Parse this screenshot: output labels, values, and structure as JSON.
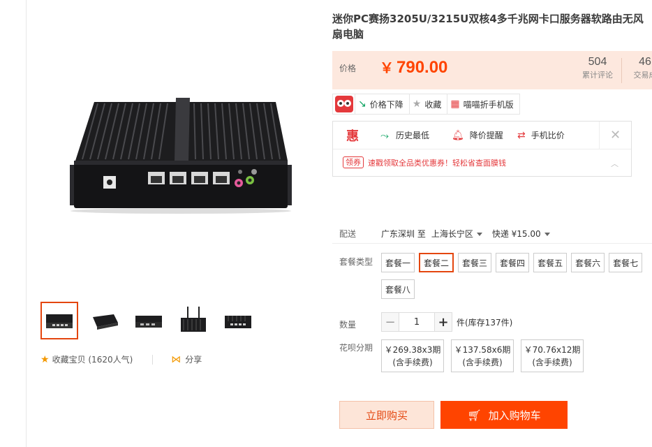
{
  "product": {
    "title": "迷你PC赛扬3205U/3215U双核4多千兆网卡口服务器软路由无风扇电脑",
    "thumbnails_count": 5
  },
  "price": {
    "label": "价格",
    "currency": "￥",
    "value": "790.00",
    "reviews_count": "504",
    "reviews_label": "累计评论",
    "deals_count": "46",
    "deals_label": "交易成"
  },
  "toolbar": {
    "price_drop": "价格下降",
    "collect": "收藏",
    "mobile": "喵喵折手机版"
  },
  "deal": {
    "hui": "惠",
    "history_low": "历史最低",
    "price_alert": "降价提醒",
    "compare": "手机比价",
    "coupon_tag": "领券",
    "coupon_text": "速戳领取全品类优惠券！轻松省查面膜钱"
  },
  "shipping": {
    "label": "配送",
    "from": "广东深圳 至",
    "to": "上海长宁区",
    "method": "快递 ¥15.00"
  },
  "package": {
    "label": "套餐类型",
    "options": [
      "套餐一",
      "套餐二",
      "套餐三",
      "套餐四",
      "套餐五",
      "套餐六",
      "套餐七",
      "套餐八"
    ],
    "selected_index": 1
  },
  "quantity": {
    "label": "数量",
    "minus": "−",
    "value": "1",
    "plus": "+",
    "stock": "件(库存137件)"
  },
  "installments": {
    "label": "花呗分期",
    "options": [
      {
        "line1": "￥269.38x3期",
        "line2": "(含手续费)"
      },
      {
        "line1": "￥137.58x6期",
        "line2": "(含手续费)"
      },
      {
        "line1": "￥70.76x12期",
        "line2": "(含手续费)"
      }
    ]
  },
  "actions": {
    "buy_now": "立即购买",
    "add_cart": "加入购物车"
  },
  "social": {
    "favorite": "收藏宝贝 (1620人气)",
    "share": "分享"
  },
  "colors": {
    "accent": "#ff4400",
    "selected_border": "#e4460f",
    "price_bg": "#fde8de"
  }
}
